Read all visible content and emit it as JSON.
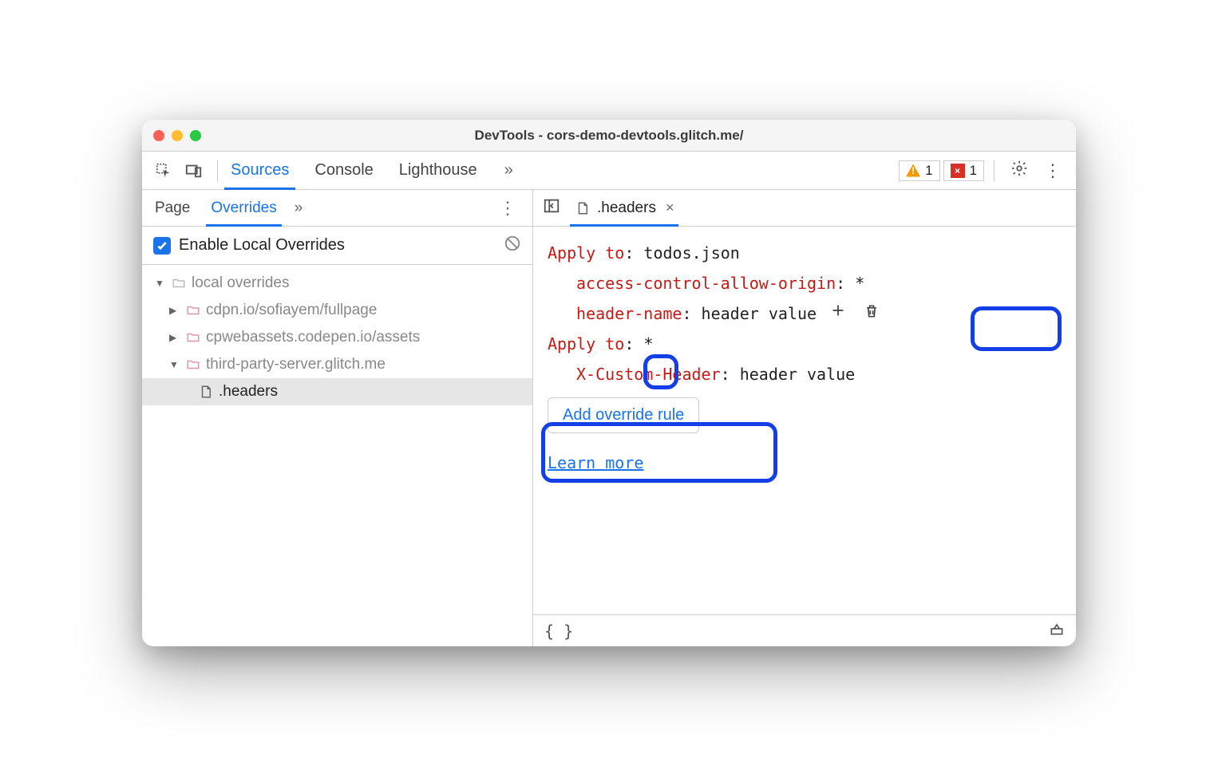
{
  "window": {
    "title": "DevTools - cors-demo-devtools.glitch.me/"
  },
  "toolbar": {
    "tabs": [
      "Sources",
      "Console",
      "Lighthouse"
    ],
    "active_tab": "Sources",
    "warn_count": "1",
    "error_count": "1"
  },
  "sidebar": {
    "tabs": [
      "Page",
      "Overrides"
    ],
    "active_tab": "Overrides",
    "enable_overrides_label": "Enable Local Overrides",
    "tree": {
      "root": "local overrides",
      "folders": [
        "cdpn.io/sofiayem/fullpage",
        "cpwebassets.codepen.io/assets",
        "third-party-server.glitch.me"
      ],
      "selected_file": ".headers"
    }
  },
  "editor": {
    "open_file": ".headers",
    "rules": [
      {
        "apply_label": "Apply to",
        "target": "todos.json",
        "headers": [
          {
            "name": "access-control-allow-origin",
            "value": "*"
          },
          {
            "name": "header-name",
            "value": "header value"
          }
        ]
      },
      {
        "apply_label": "Apply to",
        "target": "*",
        "headers": [
          {
            "name": "X-Custom-Header",
            "value": "header value"
          }
        ]
      }
    ],
    "add_rule_label": "Add override rule",
    "learn_more_label": "Learn more"
  }
}
